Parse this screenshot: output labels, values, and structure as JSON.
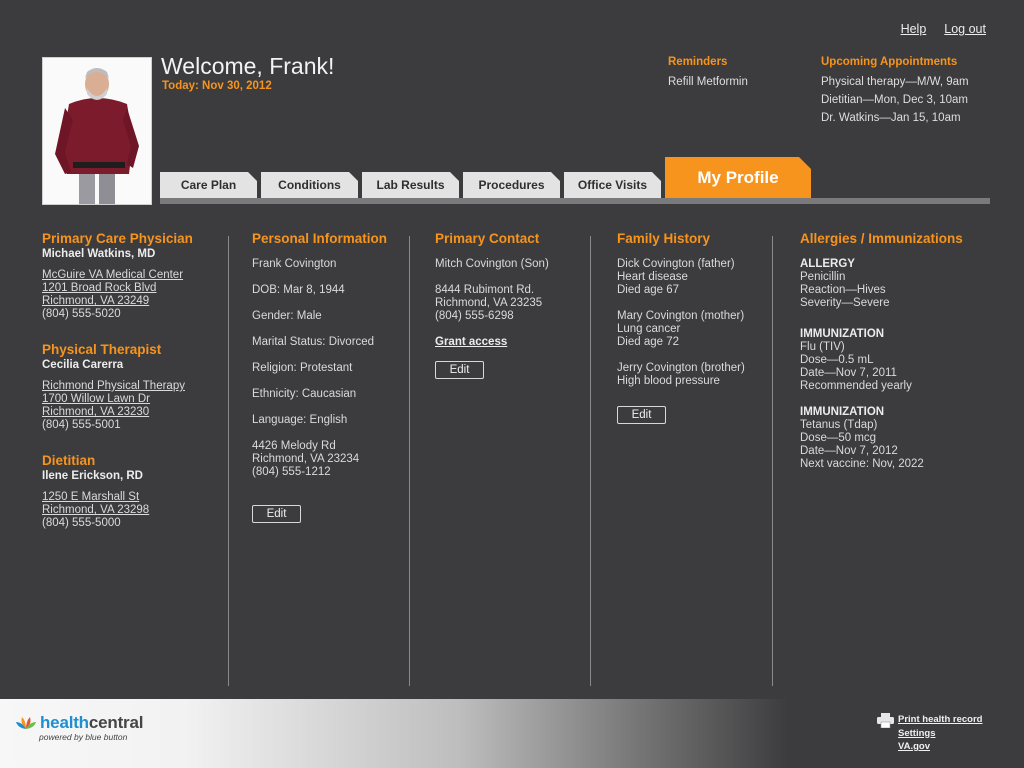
{
  "topnav": {
    "help": "Help",
    "logout": "Log out"
  },
  "header": {
    "welcome": "Welcome, Frank!",
    "today": "Today: Nov 30, 2012"
  },
  "reminders": {
    "title": "Reminders",
    "items": [
      "Refill Metformin"
    ]
  },
  "appointments": {
    "title": "Upcoming Appointments",
    "items": [
      "Physical therapy—M/W, 9am",
      "Dietitian—Mon, Dec 3, 10am",
      "Dr. Watkins—Jan 15, 10am"
    ]
  },
  "tabs": [
    "Care Plan",
    "Conditions",
    "Lab Results",
    "Procedures",
    "Office Visits",
    "My Profile"
  ],
  "providers": {
    "pcp": {
      "title": "Primary Care Physician",
      "name": "Michael Watkins, MD",
      "org": "McGuire VA Medical Center",
      "addr1": "1201 Broad Rock Blvd",
      "addr2": "Richmond, VA 23249",
      "phone": "(804) 555-5020"
    },
    "pt": {
      "title": "Physical Therapist",
      "name": "Cecilia Carerra",
      "org": "Richmond Physical Therapy",
      "addr1": "1700 Willow Lawn Dr",
      "addr2": "Richmond, VA 23230",
      "phone": "(804) 555-5001"
    },
    "diet": {
      "title": "Dietitian",
      "name": "Ilene Erickson, RD",
      "addr1": "1250 E Marshall St",
      "addr2": "Richmond, VA 23298",
      "phone": "(804) 555-5000"
    }
  },
  "personal": {
    "title": "Personal Information",
    "name": "Frank Covington",
    "dob": "DOB: Mar 8, 1944",
    "gender": "Gender: Male",
    "marital": "Marital Status: Divorced",
    "religion": "Religion: Protestant",
    "ethnicity": "Ethnicity: Caucasian",
    "language": "Language: English",
    "addr1": "4426 Melody Rd",
    "addr2": "Richmond, VA 23234",
    "phone": "(804) 555-1212",
    "edit": "Edit"
  },
  "contact": {
    "title": "Primary Contact",
    "name": "Mitch Covington (Son)",
    "addr1": "8444 Rubimont Rd.",
    "addr2": "Richmond, VA 23235",
    "phone": "(804) 555-6298",
    "grant": "Grant access",
    "edit": "Edit"
  },
  "family": {
    "title": "Family History",
    "members": [
      {
        "who": "Dick Covington (father)",
        "cond": "Heart disease",
        "note": "Died age 67"
      },
      {
        "who": "Mary Covington (mother)",
        "cond": "Lung cancer",
        "note": "Died age 72"
      },
      {
        "who": "Jerry Covington (brother)",
        "cond": "High blood pressure"
      }
    ],
    "edit": "Edit"
  },
  "allergies": {
    "title": "Allergies / Immunizations",
    "allergy": {
      "label": "ALLERGY",
      "l1": "Penicillin",
      "l2": "Reaction—Hives",
      "l3": "Severity—Severe"
    },
    "imm1": {
      "label": "IMMUNIZATION",
      "l1": "Flu (TIV)",
      "l2": "Dose—0.5 mL",
      "l3": "Date—Nov 7, 2011",
      "l4": "Recommended yearly"
    },
    "imm2": {
      "label": "IMMUNIZATION",
      "l1": "Tetanus (Tdap)",
      "l2": "Dose—50 mcg",
      "l3": "Date—Nov 7, 2012",
      "l4": "Next vaccine: Nov, 2022"
    }
  },
  "footer": {
    "logo_health": "health",
    "logo_central": "central",
    "logo_sub": "powered by blue button",
    "print": "Print health record",
    "settings": "Settings",
    "va": "VA.gov"
  },
  "colors": {
    "accent": "#f7941d",
    "background": "#3c3c3e",
    "tab": "#e3e3e3",
    "logo_blue": "#1f8fd0"
  },
  "icons": {
    "printer": "printer-icon",
    "logo": "lotus-logo-icon"
  }
}
